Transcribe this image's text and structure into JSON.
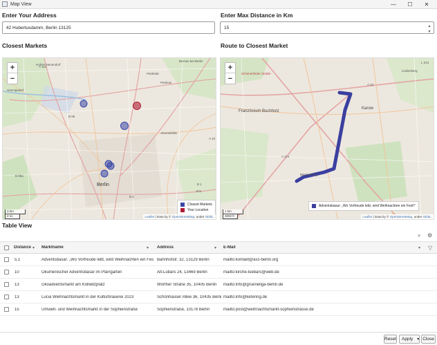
{
  "window": {
    "title": "Map View",
    "minimize": "—",
    "maximize": "☐",
    "close": "✕"
  },
  "address": {
    "label": "Enter Your Address",
    "value": "42 Hubertusdamm, Berlin 13125"
  },
  "distance": {
    "label": "Enter Max Distance in Km",
    "value": "15",
    "up": "▲",
    "down": "▼"
  },
  "closest": {
    "title": "Closest Markets",
    "zoom_in": "+",
    "zoom_out": "−",
    "scale_km": "3 km",
    "scale_mi": "2 mi",
    "places": [
      "Hohen Neuendorf",
      "Hennigsdorf",
      "Pankow",
      "Ahrensfelde",
      "Berlin",
      "Bernau bei Berlin",
      "Panketal"
    ],
    "roads": [
      "B 96",
      "B 96a",
      "B 1",
      "B 5",
      "B 2",
      "A 10",
      "A 114",
      "A 100",
      "B 5",
      "B 109",
      "B 101"
    ],
    "legend": [
      {
        "label": "Closest Markets",
        "color": "#3b47a8"
      },
      {
        "label": "Your Location",
        "color": "#b01c34"
      }
    ],
    "attribution": {
      "leaflet": "Leaflet",
      "mid": " | Data by © ",
      "osm": "OpenStreetMap",
      "under": ", under ",
      "odbl": "ODbL."
    }
  },
  "route": {
    "title": "Route to Closest Market",
    "zoom_in": "+",
    "zoom_out": "−",
    "scale_km": "1 km",
    "scale_ft": "3000 ft",
    "places": [
      "Französisch Buchholz",
      "Karow",
      "Schönerlinder Straße",
      "Blankenburg",
      "Lindenberg",
      "A 10",
      "A 114",
      "L 313"
    ],
    "popup": "Adventsbasar: „Wo Vorfreude lebt, wird Weihnachten ein Fest!“",
    "route_color": "#3b3fa0",
    "attribution": {
      "leaflet": "Leaflet",
      "mid": " | Data by © ",
      "osm": "OpenStreetMap",
      "under": ", under ",
      "odbl": "ODbL."
    }
  },
  "table": {
    "title": "Table View",
    "search_icon": "⌕",
    "settings_icon": "⚙",
    "filter_icon": "▽",
    "columns": [
      "Distance",
      "Marktname",
      "Address",
      "E-Mail"
    ],
    "rows": [
      {
        "distance": "5.1",
        "name": "Adventsbasar: „Wo Vorfreude lebt, wird Weihnachten ein Fest!“",
        "address": "Bahnhofstr. 32, 13129 Berlin",
        "email": "mailto:kontakt@ass-berlin.org"
      },
      {
        "distance": "10",
        "name": "Ökumenischer Adventsbasar im Pfarrgarten",
        "address": "Alt-Lübars 24, 13469 Berlin",
        "email": "mailto:kirche-luebars@web.de"
      },
      {
        "distance": "13",
        "name": "Ökoadventsmarkt am Kollwitzplatz",
        "address": "Wörther Straße 35, 10405 Berlin",
        "email": "mailto:info@grueneliga-berlin.de"
      },
      {
        "distance": "13",
        "name": "Lucia Weihnachtsmarkt in der Kulturbrauerei 2023",
        "address": "Schönhauser Allee 36, 10435 Berlin",
        "email": "mailto:info@ketering.de"
      },
      {
        "distance": "15",
        "name": "Umwelt- und Weihnachtsmarkt in der Sophienstraße",
        "address": "Sophienstraße, 10178 Berlin",
        "email": "mailto:post@weihnachtsmarkt-sophienstrasse.de"
      }
    ]
  },
  "footer": {
    "reset": "Reset",
    "apply": "Apply",
    "apply_arrow": "▾",
    "close": "Close"
  }
}
